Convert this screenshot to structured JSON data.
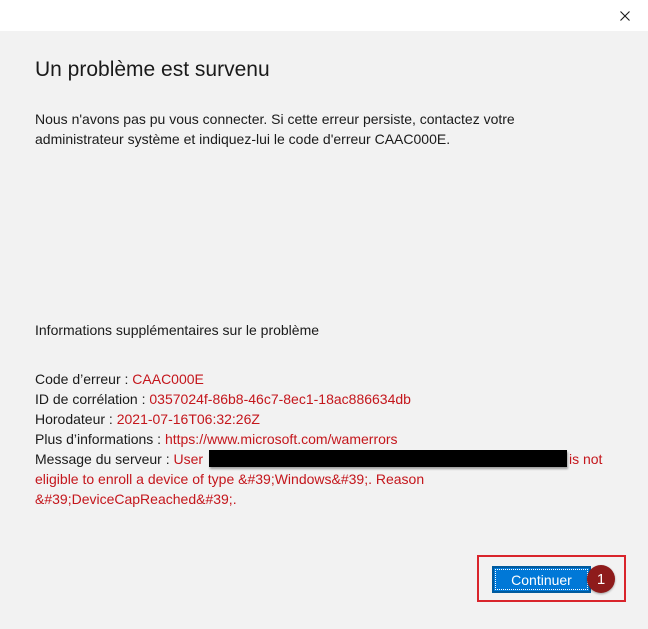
{
  "title": "Un problème est survenu",
  "message": "Nous n'avons pas pu vous connecter. Si cette erreur persiste, contactez votre administrateur système et indiquez-lui le code d'erreur CAAC000E.",
  "info_heading": "Informations supplémentaires sur le problème",
  "details": {
    "error_code_label": "Code d’erreur : ",
    "error_code": "CAAC000E",
    "correlation_label": "ID de corrélation : ",
    "correlation_id": "0357024f-86b8-46c7-8ec1-18ac886634db",
    "timestamp_label": "Horodateur : ",
    "timestamp": "2021-07-16T06:32:26Z",
    "more_info_label": "Plus d’informations : ",
    "more_info_url": "https://www.microsoft.com/wamerrors",
    "server_label": "Message du serveur : ",
    "server_prefix": "User ",
    "server_suffix": "is not eligible to enroll a device of type &#39;Windows&#39;. Reason &#39;DeviceCapReached&#39;."
  },
  "continue_label": "Continuer",
  "step_badge": "1",
  "icons": {
    "close": "close-icon"
  },
  "colors": {
    "accent": "#0078d7",
    "error_value": "#c4161c",
    "highlight": "#d9242b",
    "badge": "#8e1b1b"
  }
}
